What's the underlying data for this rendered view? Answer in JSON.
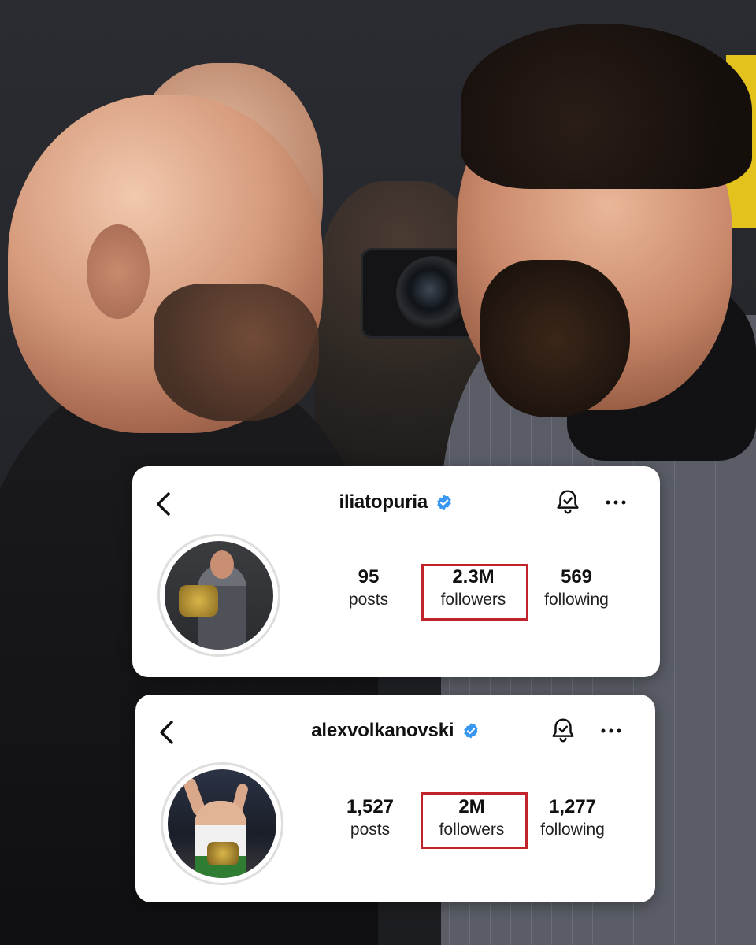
{
  "theme": {
    "verified_color": "#3897f0",
    "highlight_color": "#c0242a",
    "card_background": "#ffffff",
    "text_color": "#111111"
  },
  "profiles": [
    {
      "username": "iliatopuria",
      "verified": true,
      "icons": {
        "back": "chevron-left-icon",
        "notifications": "bell-check-icon",
        "more": "more-horizontal-icon"
      },
      "stats": {
        "posts": {
          "value": "95",
          "label": "posts"
        },
        "followers": {
          "value": "2.3M",
          "label": "followers"
        },
        "following": {
          "value": "569",
          "label": "following"
        }
      }
    },
    {
      "username": "alexvolkanovski",
      "verified": true,
      "icons": {
        "back": "chevron-left-icon",
        "notifications": "bell-check-icon",
        "more": "more-horizontal-icon"
      },
      "stats": {
        "posts": {
          "value": "1,527",
          "label": "posts"
        },
        "followers": {
          "value": "2M",
          "label": "followers"
        },
        "following": {
          "value": "1,277",
          "label": "following"
        }
      }
    }
  ]
}
